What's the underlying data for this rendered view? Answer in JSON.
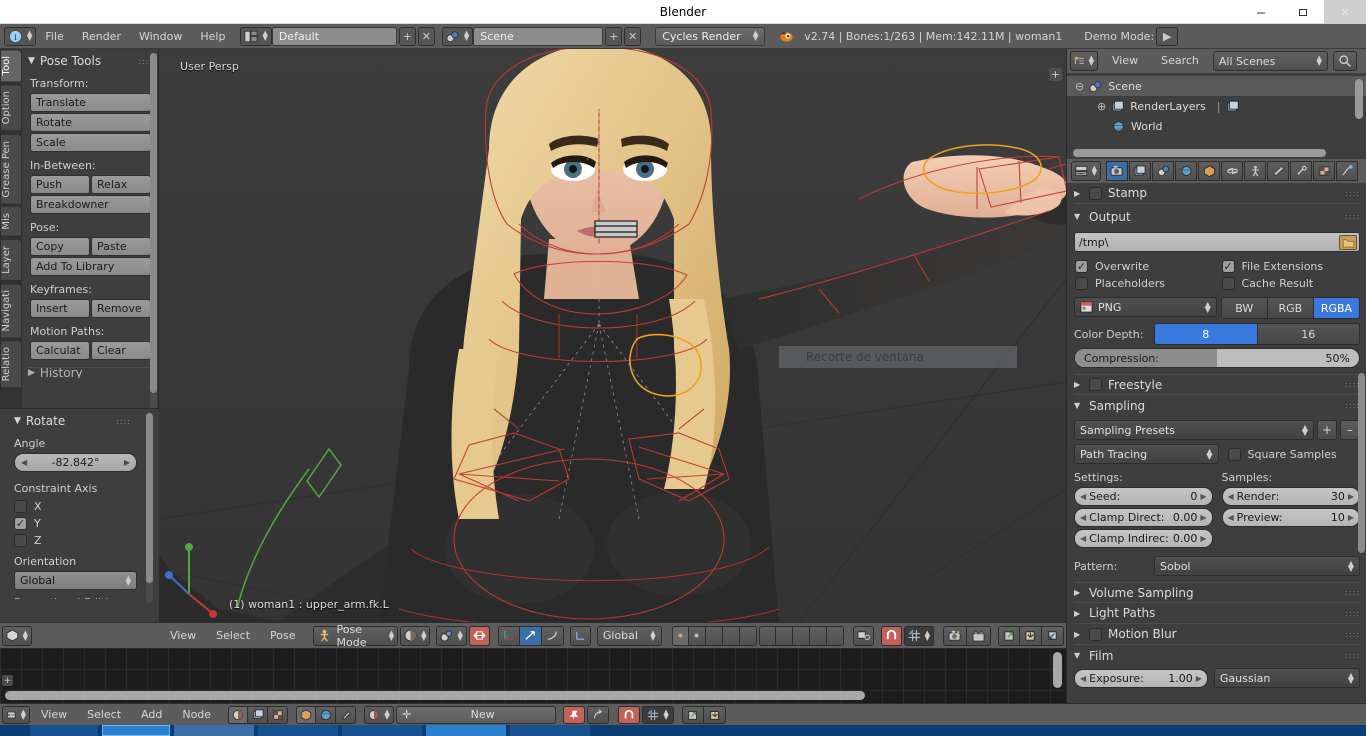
{
  "window": {
    "title": "Blender",
    "minimize": "–",
    "maximize": "❐",
    "close": "✕"
  },
  "topbar": {
    "menus": [
      "File",
      "Render",
      "Window",
      "Help"
    ],
    "screen_layout": "Default",
    "scene_name": "Scene",
    "engine": "Cycles Render",
    "status": "v2.74 | Bones:1/263  | Mem:142.11M | woman1",
    "demo_mode_label": "Demo Mode:",
    "add_icon": "+",
    "remove_icon": "✕",
    "play_icon": "▶"
  },
  "toolshelf": {
    "tabs": [
      "Tool",
      "Option",
      "Grease Pen",
      "Mis",
      "Layer",
      "Navigati",
      "Relatio"
    ],
    "active_tab": "Tool",
    "panel_title": "Pose Tools",
    "groups": [
      {
        "label": "Transform:",
        "rows": [
          [
            "Translate"
          ],
          [
            "Rotate"
          ],
          [
            "Scale"
          ]
        ]
      },
      {
        "label": "In-Between:",
        "rows": [
          [
            "Push",
            "Relax"
          ],
          [
            "Breakdowner"
          ]
        ]
      },
      {
        "label": "Pose:",
        "rows": [
          [
            "Copy",
            "Paste"
          ],
          [
            "Add To Library"
          ]
        ]
      },
      {
        "label": "Keyframes:",
        "rows": [
          [
            "Insert",
            "Remove"
          ]
        ]
      },
      {
        "label": "Motion Paths:",
        "rows": [
          [
            "Calculat",
            "Clear"
          ]
        ]
      }
    ],
    "cut_off_item": "History"
  },
  "operator_panel": {
    "title": "Rotate",
    "angle_label": "Angle",
    "angle_value": "-82.842°",
    "constraint_label": "Constraint Axis",
    "axes": [
      {
        "name": "X",
        "checked": false
      },
      {
        "name": "Y",
        "checked": true
      },
      {
        "name": "Z",
        "checked": false
      }
    ],
    "orientation_label": "Orientation",
    "orientation_value": "Global",
    "cut_off_item": "Proportional Editing"
  },
  "viewport": {
    "view_label": "User Persp",
    "object_info": "(1) woman1 : upper_arm.fk.L",
    "overlay_text": "Recorte de ventana",
    "plus_icon": "+"
  },
  "viewport_header": {
    "menus": [
      "View",
      "Select",
      "Pose"
    ],
    "mode": "Pose Mode",
    "transform_orientation": "Global",
    "editor_icon": "cube-icon",
    "mode_icon": "pose-mode-icon",
    "shading_icon": "solid-shading-icon",
    "pivot_icon": "pivot-icon",
    "mirror_icon": "x-mirror-icon",
    "manipulator_icons": [
      "translate-manipulator-icon",
      "rotate-manipulator-icon",
      "scale-manipulator-icon"
    ],
    "snap_icon": "magnet-icon",
    "snap_element_icon": "snap-element-icon",
    "render_icon": "render-camera-icon",
    "animation_icon": "render-animation-icon",
    "pose_copy_icons": [
      "copy-pose-icon",
      "paste-pose-icon",
      "paste-flipped-pose-icon"
    ]
  },
  "node_editor_header": {
    "menus": [
      "View",
      "Select",
      "Add",
      "Node"
    ],
    "new_button": "New",
    "shader_type_icons": [
      "material-icon",
      "world-icon",
      "lamp-icon"
    ],
    "tree_type_icons": [
      "shader-nodes-icon",
      "compositing-nodes-icon",
      "texture-nodes-icon"
    ],
    "pin_icon": "pin-icon",
    "go_parent_icon": "go-to-parent-icon",
    "snap_icon": "magnet-icon",
    "snap_node_icon": "snap-node-icon",
    "copy_icons": [
      "copy-icon",
      "paste-icon"
    ],
    "add_icon": "+"
  },
  "outliner": {
    "view_label": "View",
    "search_label": "Search",
    "display_mode": "All Scenes",
    "search_icon": "magnifier-icon",
    "display_icon": "outliner-icon",
    "rows": [
      {
        "label": "Scene",
        "indent": 0,
        "expander": "⊖",
        "icon": "scene-icon",
        "selected": true
      },
      {
        "label": "RenderLayers",
        "indent": 1,
        "expander": "⊕",
        "icon": "renderlayer-icon",
        "selected": false
      },
      {
        "label": "World",
        "indent": 1,
        "expander": "",
        "icon": "world-icon",
        "selected": false
      }
    ]
  },
  "properties": {
    "tabs": [
      "render-tab",
      "renderlayers-tab",
      "scene-tab",
      "world-tab",
      "object-tab",
      "constraints-tab",
      "armature-tab",
      "bone-tab",
      "bone-constraint-tab",
      "texture-tab",
      "particles-tab"
    ],
    "active_tab_index": 0,
    "sections": {
      "stamp": {
        "title": "Stamp",
        "open": false,
        "has_checkbox": true
      },
      "output": {
        "title": "Output",
        "open": true,
        "path": "/tmp\\",
        "folder_icon": "folder-icon",
        "checkboxes": [
          {
            "label": "Overwrite",
            "checked": true
          },
          {
            "label": "File Extensions",
            "checked": true
          },
          {
            "label": "Placeholders",
            "checked": false
          },
          {
            "label": "Cache Result",
            "checked": false
          }
        ],
        "file_format": "PNG",
        "file_format_icon": "image-file-icon",
        "color_modes": [
          "BW",
          "RGB",
          "RGBA"
        ],
        "color_mode_active": "RGBA",
        "color_depth_label": "Color Depth:",
        "color_depths": [
          "8",
          "16"
        ],
        "color_depth_active": "8",
        "compression_label": "Compression:",
        "compression_value": "50%",
        "compression_pct": 50
      },
      "freestyle": {
        "title": "Freestyle",
        "open": false,
        "has_checkbox": true
      },
      "sampling": {
        "title": "Sampling",
        "open": true,
        "presets": "Sampling Presets",
        "preset_add_icon": "+",
        "preset_remove_icon": "–",
        "integrator": "Path Tracing",
        "square_samples_label": "Square Samples",
        "square_samples_checked": false,
        "settings_label": "Settings:",
        "samples_label": "Samples:",
        "settings_fields": [
          {
            "label": "Seed:",
            "value": "0"
          },
          {
            "label": "Clamp Direct:",
            "value": "0.00"
          },
          {
            "label": "Clamp Indirec:",
            "value": "0.00"
          }
        ],
        "samples_fields": [
          {
            "label": "Render:",
            "value": "30"
          },
          {
            "label": "Preview:",
            "value": "10"
          }
        ],
        "pattern_label": "Pattern:",
        "pattern_value": "Sobol"
      },
      "volume_sampling": {
        "title": "Volume Sampling",
        "open": false,
        "has_checkbox": false
      },
      "light_paths": {
        "title": "Light Paths",
        "open": false,
        "has_checkbox": false
      },
      "motion_blur": {
        "title": "Motion Blur",
        "open": false,
        "has_checkbox": true
      },
      "film": {
        "title": "Film",
        "open": true,
        "exposure_label": "Exposure:",
        "exposure_value": "1.00",
        "filter_type": "Gaussian"
      }
    }
  }
}
